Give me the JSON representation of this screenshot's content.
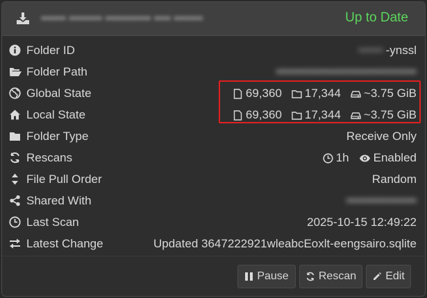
{
  "header": {
    "title": "•••••• •••••••• ••••••••••• •••• •••••••",
    "status": "Up to Date",
    "status_color": "#5cd65c",
    "icon": "download-icon"
  },
  "rows": {
    "folder_id": {
      "label": "Folder ID",
      "value_blur": "••••••",
      "value": "-ynssl"
    },
    "folder_path": {
      "label": "Folder Path",
      "value": "••••••••••••••••••••••••••••••••••"
    },
    "global_state": {
      "label": "Global State",
      "files": "69,360",
      "dirs": "17,344",
      "size": "~3.75 GiB"
    },
    "local_state": {
      "label": "Local State",
      "files": "69,360",
      "dirs": "17,344",
      "size": "~3.75 GiB"
    },
    "folder_type": {
      "label": "Folder Type",
      "value": "Receive Only"
    },
    "rescans": {
      "label": "Rescans",
      "interval": "1h",
      "watcher": "Enabled"
    },
    "file_pull_order": {
      "label": "File Pull Order",
      "value": "Random"
    },
    "shared_with": {
      "label": "Shared With",
      "value": "•••••••••••••••••"
    },
    "last_scan": {
      "label": "Last Scan",
      "value": "2025-10-15 12:49:22"
    },
    "latest_change": {
      "label": "Latest Change",
      "value": "Updated 3647222921wleabcEoxlt-eengsairo.sqlite"
    }
  },
  "buttons": {
    "pause": "Pause",
    "rescan": "Rescan",
    "edit": "Edit"
  },
  "highlight_color": "#e02020"
}
